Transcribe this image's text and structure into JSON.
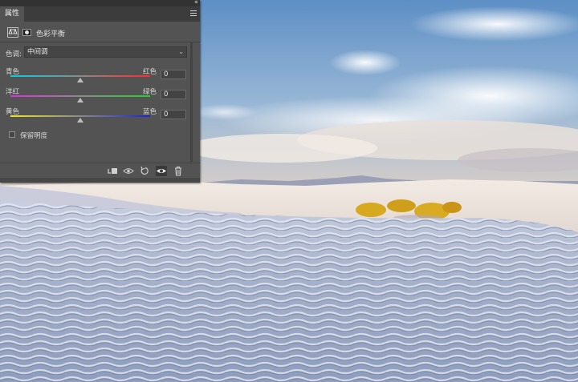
{
  "panel": {
    "tab_label": "属性",
    "collapse_glyph": "‹‹",
    "adjustment_title": "色彩平衡",
    "tone": {
      "label": "色调:",
      "selected": "中间调"
    },
    "sliders": [
      {
        "left_label": "青色",
        "right_label": "红色",
        "value": "0",
        "position": 0.5
      },
      {
        "left_label": "洋红",
        "right_label": "绿色",
        "value": "0",
        "position": 0.5
      },
      {
        "left_label": "黄色",
        "right_label": "蓝色",
        "value": "0",
        "position": 0.5
      }
    ],
    "preserve_luminosity": {
      "label": "保留明度",
      "checked": false
    },
    "footer_icons": [
      "clip-to-layer-icon",
      "view-previous-state-icon",
      "reset-icon",
      "visibility-eye-icon",
      "trash-icon"
    ]
  },
  "colors": {
    "panel_bg": "#535353",
    "cyan_red": [
      "#00d2e6",
      "#ff2b2b"
    ],
    "magenta_green": [
      "#e02ee0",
      "#22d12a"
    ],
    "yellow_blue": [
      "#f0e61e",
      "#1c24d6"
    ]
  }
}
